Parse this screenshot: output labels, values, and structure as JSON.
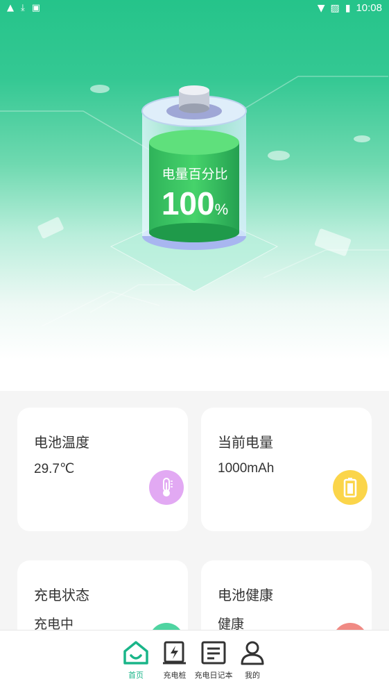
{
  "status_bar": {
    "time": "10:08"
  },
  "hero": {
    "label": "电量百分比",
    "value": "100",
    "unit": "%"
  },
  "cards": [
    {
      "title": "电池温度",
      "value": "29.7℃",
      "icon": "thermometer-icon",
      "color": "#e2a9f3"
    },
    {
      "title": "当前电量",
      "value": "1000mAh",
      "icon": "battery-icon",
      "color": "#fbd54a"
    },
    {
      "title": "充电状态",
      "value": "充电中",
      "icon": "charging-icon",
      "color": "#4fd4a1"
    },
    {
      "title": "电池健康",
      "value": "健康",
      "icon": "health-icon",
      "color": "#f08a84"
    }
  ],
  "nav": {
    "items": [
      {
        "label": "首页",
        "icon": "home-icon",
        "active": true
      },
      {
        "label": "充电桩",
        "icon": "charging-station-icon"
      },
      {
        "label": "充电日记本",
        "icon": "notebook-icon"
      },
      {
        "label": "我的",
        "icon": "profile-icon"
      }
    ],
    "active_color": "#1ab589"
  }
}
